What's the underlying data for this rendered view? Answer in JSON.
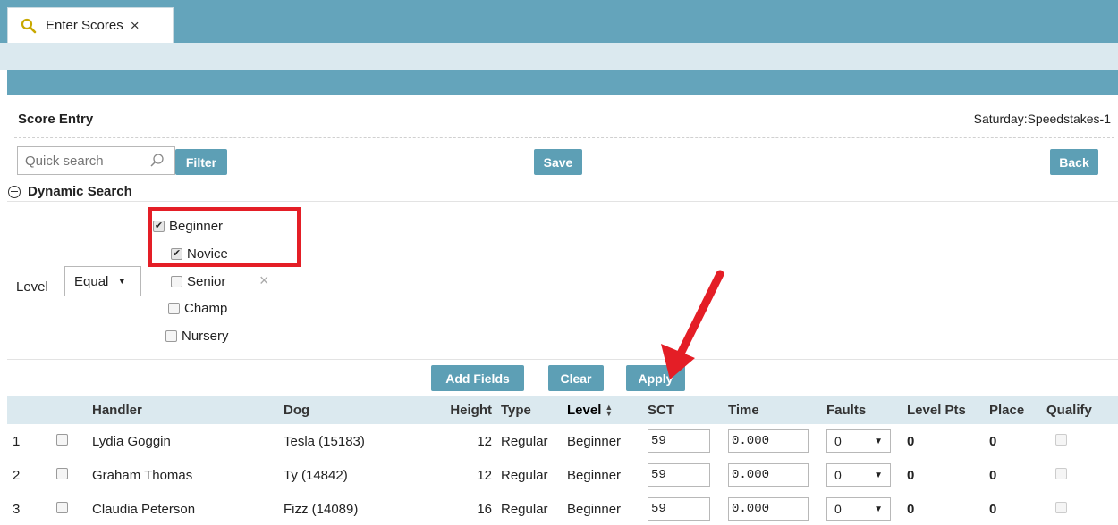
{
  "tab": {
    "label": "Enter Scores",
    "close": "×"
  },
  "header": {
    "title": "Score Entry",
    "subtitle": "Saturday:Speedstakes-1"
  },
  "toolbar": {
    "search_placeholder": "Quick search",
    "filter_label": "Filter",
    "save_label": "Save",
    "back_label": "Back"
  },
  "dynamic_search": {
    "title": "Dynamic Search",
    "level_label": "Level",
    "operator": "Equal",
    "options": [
      {
        "label": "Beginner",
        "checked": true
      },
      {
        "label": "Novice",
        "checked": true
      },
      {
        "label": "Senior",
        "checked": false
      },
      {
        "label": "Champ",
        "checked": false
      },
      {
        "label": "Nursery",
        "checked": false
      }
    ],
    "remove": "×",
    "add_fields_label": "Add Fields",
    "clear_label": "Clear",
    "apply_label": "Apply"
  },
  "table": {
    "columns": [
      "",
      "",
      "Handler",
      "Dog",
      "Height",
      "Type",
      "Level",
      "SCT",
      "Time",
      "Faults",
      "Level Pts",
      "Place",
      "Qualify"
    ],
    "rows": [
      {
        "num": "1",
        "handler": "Lydia Goggin",
        "dog": "Tesla (15183)",
        "height": "12",
        "type": "Regular",
        "level": "Beginner",
        "sct": "59",
        "time": "0.000",
        "faults": "0",
        "level_pts": "0",
        "place": "0"
      },
      {
        "num": "2",
        "handler": "Graham Thomas",
        "dog": "Ty (14842)",
        "height": "12",
        "type": "Regular",
        "level": "Beginner",
        "sct": "59",
        "time": "0.000",
        "faults": "0",
        "level_pts": "0",
        "place": "0"
      },
      {
        "num": "3",
        "handler": "Claudia Peterson",
        "dog": "Fizz (14089)",
        "height": "16",
        "type": "Regular",
        "level": "Beginner",
        "sct": "59",
        "time": "0.000",
        "faults": "0",
        "level_pts": "0",
        "place": "0"
      }
    ]
  },
  "colors": {
    "accent": "#5d9fb5",
    "band": "#64a4bb",
    "highlight": "#e41e26"
  }
}
